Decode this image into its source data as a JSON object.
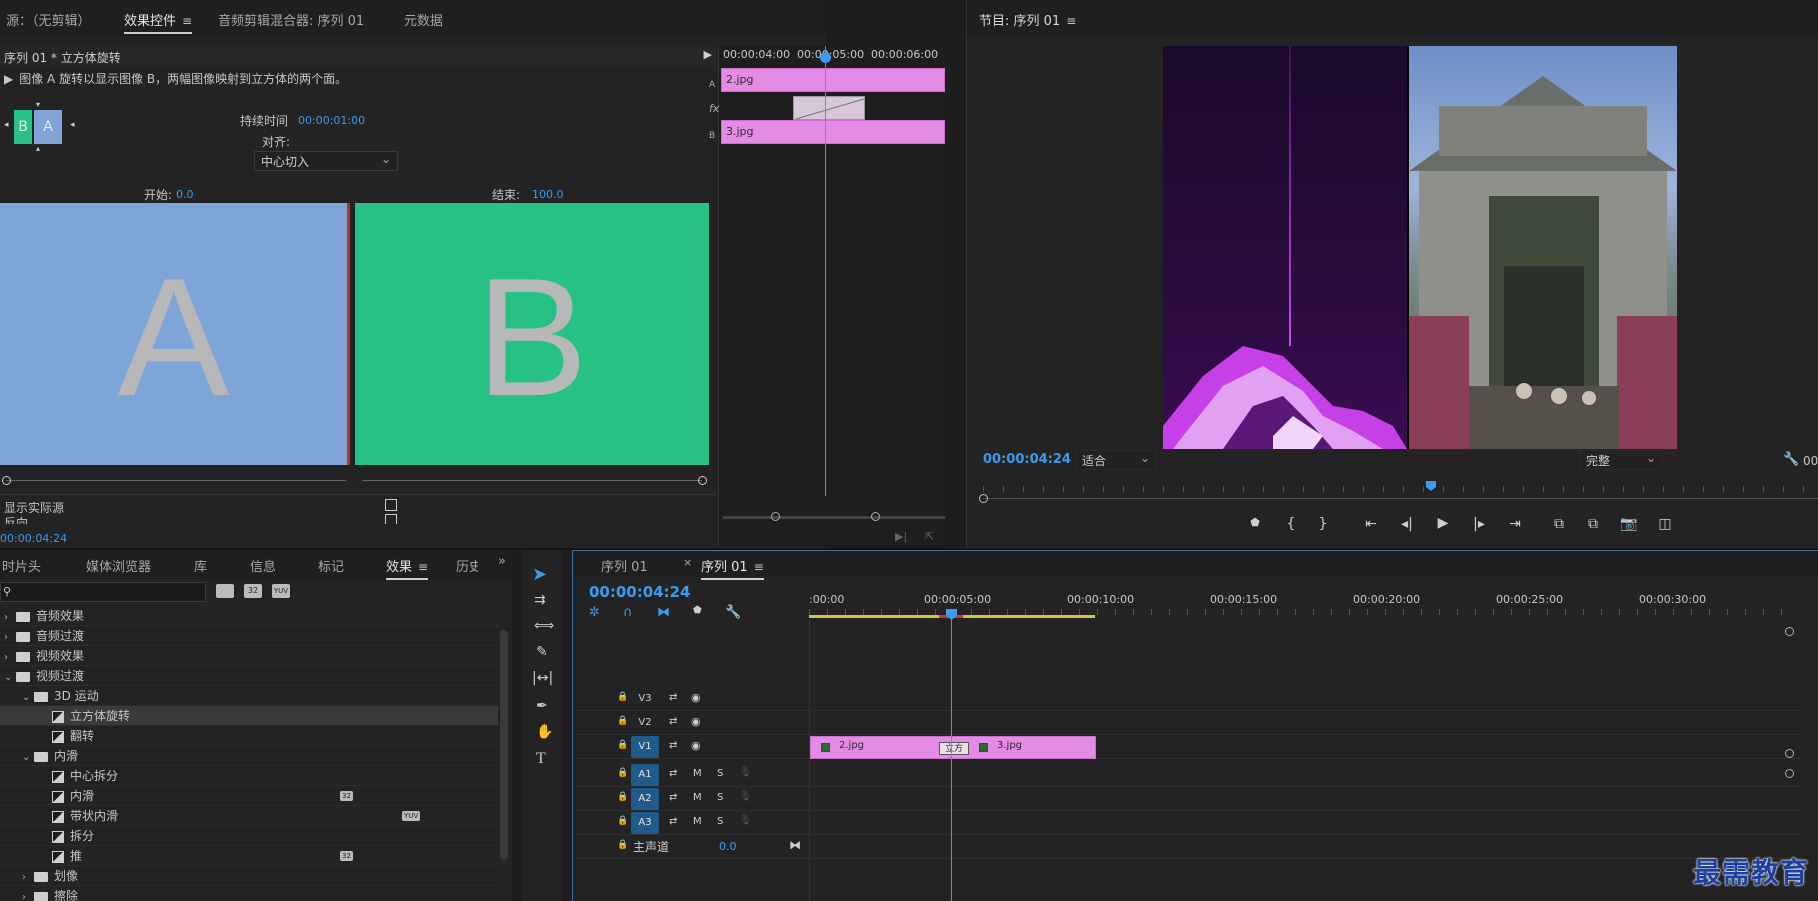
{
  "effect_controls": {
    "tabs": [
      "源：（无剪辑）",
      "效果控件",
      "音频剪辑混合器: 序列 01",
      "元数据"
    ],
    "header": "序列 01 * 立方体旋转",
    "description": "图像 A 旋转以显示图像 B，两幅图像映射到立方体的两个面。",
    "duration_label": "持续时间",
    "duration_value": "00:00:01:00",
    "align_label": "对齐:",
    "align_value": "中心切入",
    "start_label": "开始:",
    "start_value": "0.0",
    "end_label": "结束:",
    "end_value": "100.0",
    "preview_a": "A",
    "preview_b": "B",
    "thumb_a": "B",
    "thumb_b": "A",
    "show_actual_source": "显示实际源",
    "reverse": "反向",
    "timecode": "00:00:04:24",
    "mini_ruler": [
      "00:00:04:00",
      "00:00:05:00",
      "00:00:06:00"
    ],
    "track_a_label": "A",
    "track_b_label": "B",
    "fx_label": "fx",
    "clip_a": "2.jpg",
    "clip_b": "3.jpg"
  },
  "program": {
    "title": "节目: 序列 01",
    "timecode": "00:00:04:24",
    "zoom": "适合",
    "quality": "完整",
    "extra_timecode": "00"
  },
  "effects_panel": {
    "tabs": [
      "时片头",
      "媒体浏览器",
      "库",
      "信息",
      "标记",
      "效果",
      "历史"
    ],
    "active_tab": "效果",
    "tree": [
      {
        "label": "音频效果",
        "level": 0,
        "kind": "folder",
        "open": false
      },
      {
        "label": "音频过渡",
        "level": 0,
        "kind": "folder",
        "open": false
      },
      {
        "label": "视频效果",
        "level": 0,
        "kind": "folder",
        "open": false
      },
      {
        "label": "视频过渡",
        "level": 0,
        "kind": "folder",
        "open": true
      },
      {
        "label": "3D 运动",
        "level": 1,
        "kind": "folder",
        "open": true
      },
      {
        "label": "立方体旋转",
        "level": 2,
        "kind": "fx",
        "selected": true
      },
      {
        "label": "翻转",
        "level": 2,
        "kind": "fx"
      },
      {
        "label": "内滑",
        "level": 1,
        "kind": "folder",
        "open": true
      },
      {
        "label": "中心拆分",
        "level": 2,
        "kind": "fx"
      },
      {
        "label": "内滑",
        "level": 2,
        "kind": "fx",
        "badge": "32"
      },
      {
        "label": "带状内滑",
        "level": 2,
        "kind": "fx",
        "badge": "YUV"
      },
      {
        "label": "拆分",
        "level": 2,
        "kind": "fx"
      },
      {
        "label": "推",
        "level": 2,
        "kind": "fx",
        "badge": "32"
      },
      {
        "label": "划像",
        "level": 1,
        "kind": "folder",
        "open": false
      },
      {
        "label": "擦除",
        "level": 1,
        "kind": "folder",
        "open": false
      }
    ]
  },
  "timeline": {
    "tabs": [
      "序列 01",
      "序列 01"
    ],
    "timecode": "00:00:04:24",
    "ruler": [
      ":00:00",
      "00:00:05:00",
      "00:00:10:00",
      "00:00:15:00",
      "00:00:20:00",
      "00:00:25:00",
      "00:00:30:00"
    ],
    "video_tracks": [
      "V3",
      "V2",
      "V1"
    ],
    "audio_tracks": [
      "A1",
      "A2",
      "A3"
    ],
    "master_label": "主声道",
    "master_value": "0.0",
    "clip_1": "2.jpg",
    "clip_2": "3.jpg",
    "transition_label": "立方",
    "mute": "M",
    "solo": "S"
  },
  "watermark": "最需教育",
  "colors": {
    "accent": "#3c9bf0",
    "clip": "#e58ae5",
    "slide_a": "#7fa4d8",
    "slide_b": "#27c184"
  }
}
